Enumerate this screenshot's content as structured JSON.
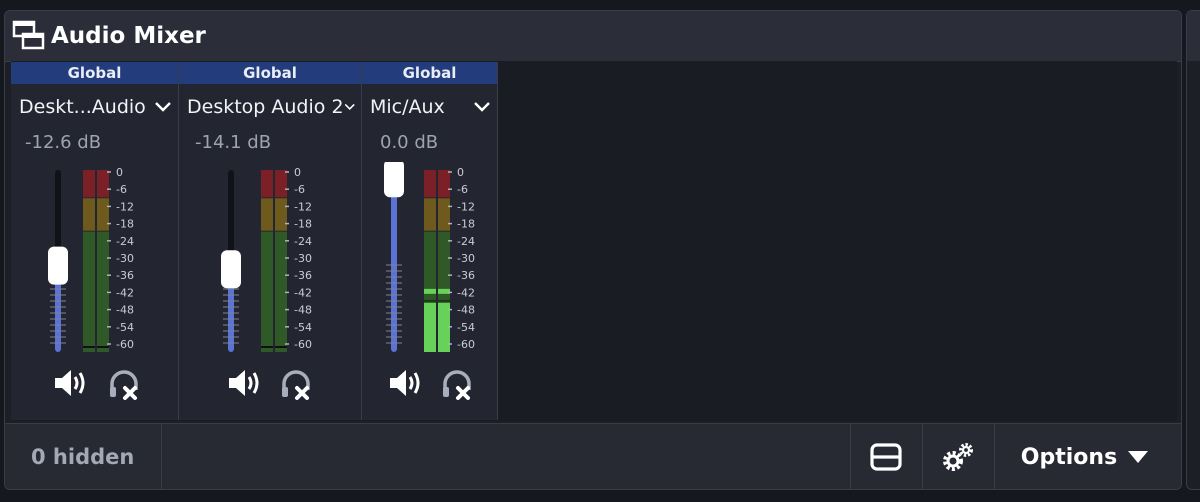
{
  "dock": {
    "title": "Audio Mixer"
  },
  "mixer": {
    "channels": [
      {
        "header": "Global",
        "name": "Deskt...Audio",
        "db": "-12.6 dB",
        "fader_level": 0.48,
        "meter_peak": 0.0
      },
      {
        "header": "Global",
        "name": "Desktop Audio 2",
        "db": "-14.1 dB",
        "fader_level": 0.46,
        "meter_peak": 0.0
      },
      {
        "header": "Global",
        "name": "Mic/Aux",
        "db": "0.0 dB",
        "fader_level": 0.96,
        "meter_peak": 0.27
      }
    ],
    "scale_labels": [
      "0",
      "-6",
      "-12",
      "-18",
      "-24",
      "-30",
      "-36",
      "-42",
      "-48",
      "-54",
      "-60"
    ]
  },
  "footer": {
    "hidden_count": "0 hidden",
    "options_label": "Options"
  },
  "icons": {
    "dock-float": "dock-float-icon",
    "speaker": "speaker-icon",
    "monitor": "headphones-muted-icon",
    "layout": "layout-toggle-icon",
    "settings": "gears-icon",
    "dropdown": "caret-down-icon"
  },
  "colors": {
    "global_header": "#233c7c",
    "fader_fill": "#5b73d6",
    "meter_red": "#7a2026",
    "meter_yellow": "#6f5a1e",
    "meter_green": "#2f5a27",
    "meter_active": "#66d25a"
  }
}
